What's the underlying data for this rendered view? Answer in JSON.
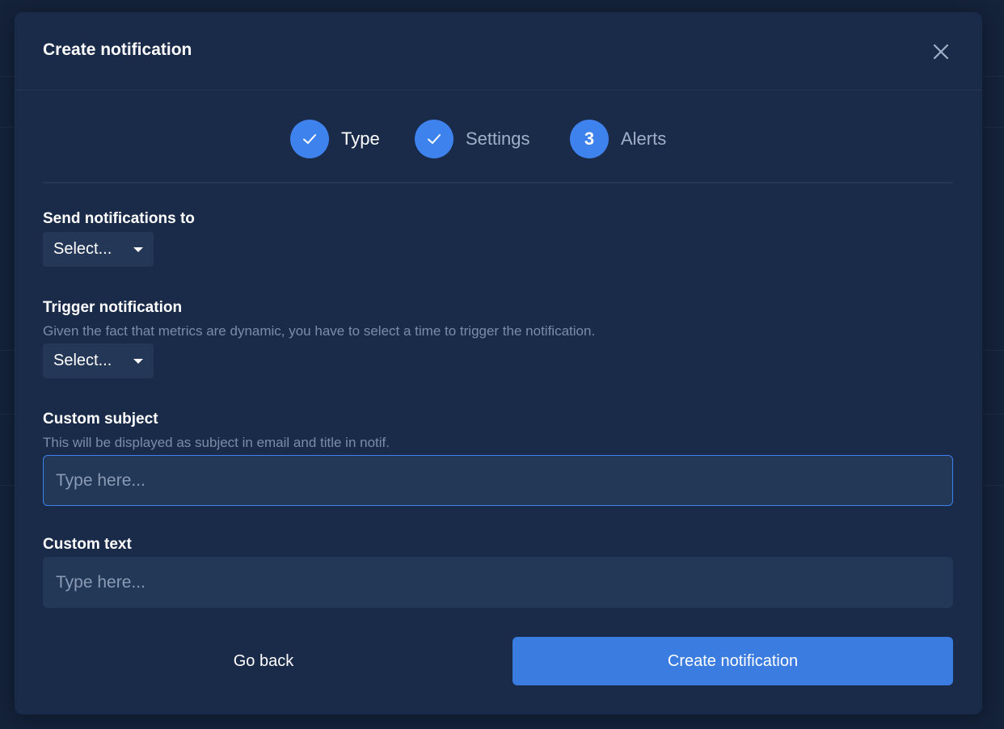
{
  "modal": {
    "title": "Create notification"
  },
  "stepper": {
    "steps": [
      {
        "label": "Type",
        "state": "done",
        "icon": "check-icon"
      },
      {
        "label": "Settings",
        "state": "done",
        "icon": "check-icon"
      },
      {
        "label": "Alerts",
        "state": "current",
        "number": "3"
      }
    ]
  },
  "form": {
    "send_to": {
      "label": "Send notifications to",
      "value": "Select..."
    },
    "trigger": {
      "label": "Trigger notification",
      "help": "Given the fact that metrics are dynamic, you have to select a time to trigger the notification.",
      "value": "Select..."
    },
    "custom_subject": {
      "label": "Custom subject",
      "help": "This will be displayed as subject in email and title in notif.",
      "placeholder": "Type here..."
    },
    "custom_text": {
      "label": "Custom text",
      "placeholder": "Type here..."
    }
  },
  "actions": {
    "back_label": "Go back",
    "create_label": "Create notification"
  },
  "colors": {
    "background": "#14223a",
    "modal": "#1a2b4a",
    "accent": "#3d82ed",
    "input": "#233757"
  }
}
